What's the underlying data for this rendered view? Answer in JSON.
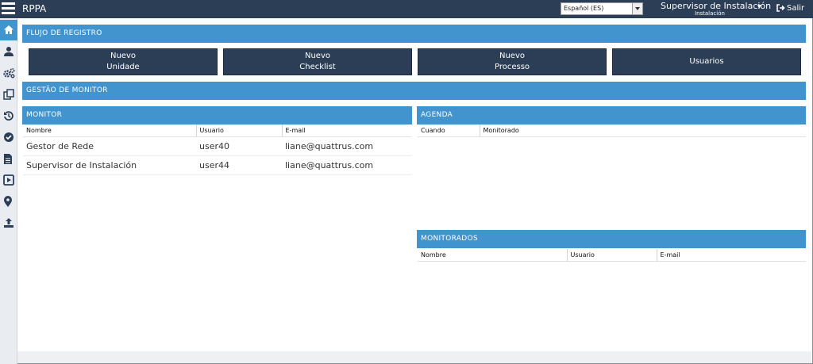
{
  "app": {
    "title": "RPPA"
  },
  "header": {
    "language": "Español (ES)",
    "user_name": "Supervisor de Instalación",
    "user_role": "Instalación",
    "logout": "Salir"
  },
  "sidebar": {
    "items": [
      {
        "icon": "home-icon",
        "active": true
      },
      {
        "icon": "user-icon",
        "active": false
      },
      {
        "icon": "gears-icon",
        "active": false
      },
      {
        "icon": "copy-icon",
        "active": false
      },
      {
        "icon": "history-icon",
        "active": false
      },
      {
        "icon": "check-circle-icon",
        "active": false
      },
      {
        "icon": "file-icon",
        "active": false
      },
      {
        "icon": "play-square-icon",
        "active": false
      },
      {
        "icon": "map-marker-icon",
        "active": false
      },
      {
        "icon": "upload-icon",
        "active": false
      }
    ]
  },
  "flujo": {
    "title": "FLUJO DE REGISTRO",
    "buttons": [
      {
        "line1": "Nuevo",
        "line2": "Unidade"
      },
      {
        "line1": "Nuevo",
        "line2": "Checklist"
      },
      {
        "line1": "Nuevo",
        "line2": "Processo"
      },
      {
        "line1": "Usuarios",
        "line2": ""
      }
    ]
  },
  "gestao": {
    "title": "GESTÃO DE MONITOR"
  },
  "monitor": {
    "title": "MONITOR",
    "columns": [
      "Nombre",
      "Usuario",
      "E-mail"
    ],
    "rows": [
      [
        "Gestor de Rede",
        "user40",
        "liane@quattrus.com"
      ],
      [
        "Supervisor de Instalación",
        "user44",
        "liane@quattrus.com"
      ]
    ]
  },
  "agenda": {
    "title": "AGENDA",
    "columns": [
      "Cuando",
      "Monitorado"
    ]
  },
  "monitorados": {
    "title": "MONITORADOS",
    "columns": [
      "Nombre",
      "Usuario",
      "E-mail"
    ]
  },
  "colors": {
    "topbar": "#2c3e56",
    "accent": "#4294cf",
    "sidebar": "#e9ecf1"
  }
}
